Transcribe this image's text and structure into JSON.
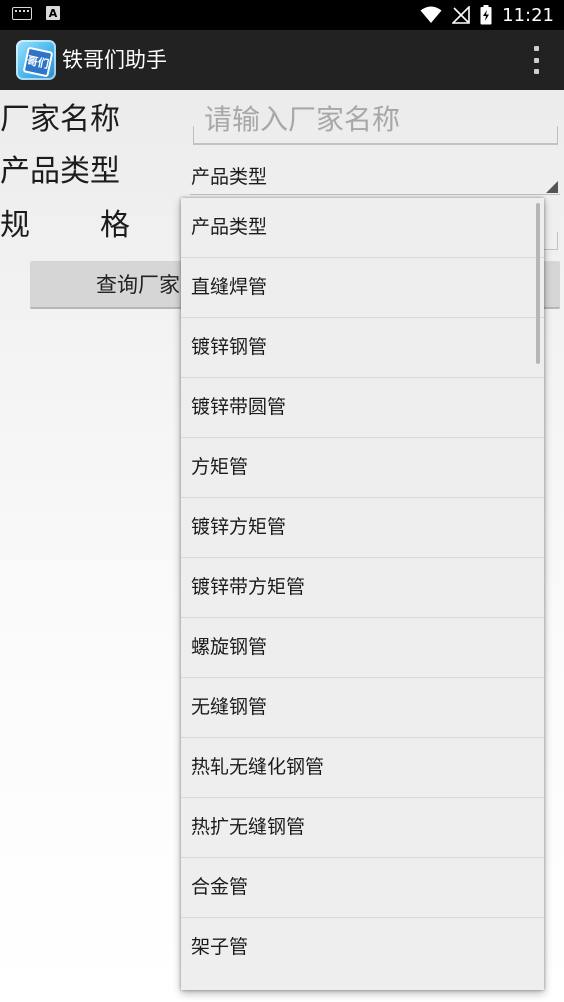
{
  "status_bar": {
    "time": "11:21",
    "left_icons": [
      "keyboard-icon",
      "a-icon"
    ],
    "a_letter": "A",
    "right_icons": [
      "wifi-icon",
      "no-signal-icon",
      "battery-charging-icon"
    ]
  },
  "action_bar": {
    "app_icon_text": "哥们",
    "title": "铁哥们助手",
    "overflow_icon": "more-vert-icon"
  },
  "form": {
    "factory_label": "厂家名称",
    "factory_placeholder": "请输入厂家名称",
    "factory_value": "",
    "type_label": "产品类型",
    "type_selected": "产品类型",
    "spec_label_1": "规",
    "spec_label_2": "格",
    "query_button": "查询厂家"
  },
  "dropdown": {
    "options": [
      "产品类型",
      "直缝焊管",
      "镀锌钢管",
      "镀锌带圆管",
      "方矩管",
      "镀锌方矩管",
      "镀锌带方矩管",
      "螺旋钢管",
      "无缝钢管",
      "热轧无缝化钢管",
      "热扩无缝钢管",
      "合金管",
      "架子管"
    ]
  },
  "colors": {
    "status_bar_bg": "#000000",
    "action_bar_bg": "#222222",
    "dropdown_bg": "#eeeeee",
    "button_bg": "#d6d6d6"
  }
}
